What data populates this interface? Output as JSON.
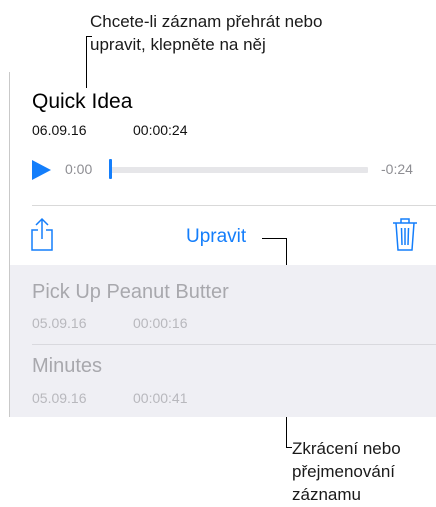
{
  "callouts": {
    "top_line1": "Chcete-li záznam přehrát nebo",
    "top_line2": "upravit, klepněte na něj",
    "bottom_line1": "Zkrácení nebo",
    "bottom_line2": "přejmenování",
    "bottom_line3": "záznamu"
  },
  "selected_recording": {
    "title": "Quick Idea",
    "date": "06.09.16",
    "duration": "00:00:24",
    "time_elapsed": "0:00",
    "time_remaining": "-0:24",
    "playback_progress": 0
  },
  "actions": {
    "share_icon": "share-icon",
    "edit_label": "Upravit",
    "trash_icon": "trash-icon",
    "play_icon": "play-icon"
  },
  "recordings": [
    {
      "title": "Pick Up Peanut Butter",
      "date": "05.09.16",
      "duration": "00:00:16"
    },
    {
      "title": "Minutes",
      "date": "05.09.16",
      "duration": "00:00:41"
    }
  ],
  "colors": {
    "accent": "#147efb",
    "list_background": "#efeff4",
    "muted_text": "#a8a8ad"
  }
}
